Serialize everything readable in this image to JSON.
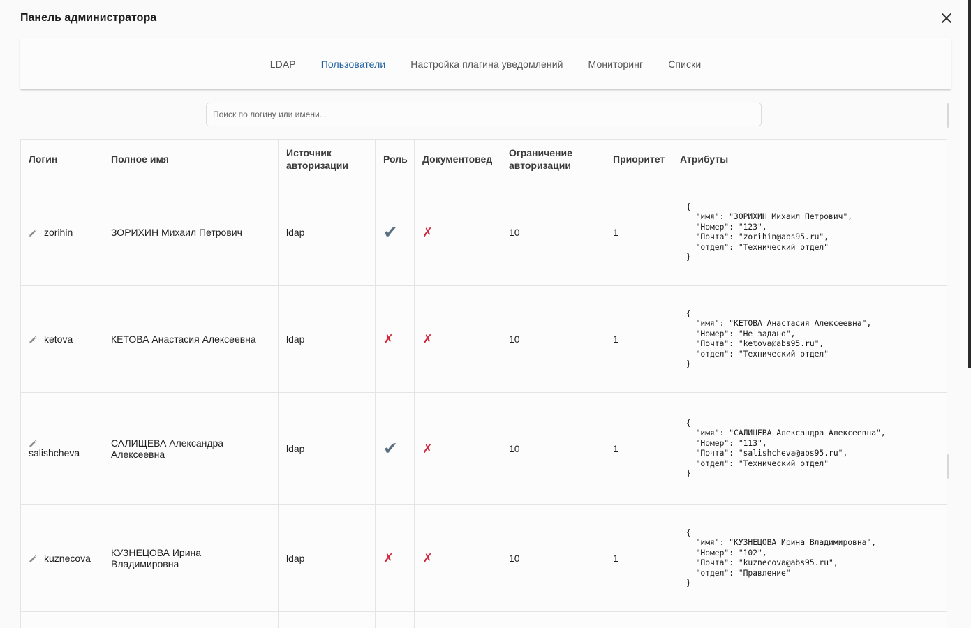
{
  "dialog": {
    "title": "Панель администратора"
  },
  "tabs": [
    {
      "label": "LDAP",
      "active": false
    },
    {
      "label": "Пользователи",
      "active": true
    },
    {
      "label": "Настройка плагина уведомлений",
      "active": false
    },
    {
      "label": "Мониторинг",
      "active": false
    },
    {
      "label": "Списки",
      "active": false
    }
  ],
  "search": {
    "placeholder": "Поиск по логину или имени...",
    "value": ""
  },
  "table": {
    "headers": {
      "login": "Логин",
      "full_name": "Полное имя",
      "auth_source": "Источник авторизации",
      "role": "Роль",
      "doc_manager": "Документовед",
      "auth_limit": "Ограничение авторизации",
      "priority": "Приоритет",
      "attributes": "Атрибуты"
    },
    "rows": [
      {
        "login": "zorihin",
        "full_name": "ЗОРИХИН Михаил Петрович",
        "auth_source": "ldap",
        "role": true,
        "doc_manager": false,
        "auth_limit": "10",
        "priority": "1",
        "attributes": "{\n  \"имя\": \"ЗОРИХИН Михаил Петрович\",\n  \"Номер\": \"123\",\n  \"Почта\": \"zorihin@abs95.ru\",\n  \"отдел\": \"Технический отдел\"\n}"
      },
      {
        "login": "ketova",
        "full_name": "КЕТОВА Анастасия Алексеевна",
        "auth_source": "ldap",
        "role": false,
        "doc_manager": false,
        "auth_limit": "10",
        "priority": "1",
        "attributes": "{\n  \"имя\": \"КЕТОВА Анастасия Алексеевна\",\n  \"Номер\": \"Не задано\",\n  \"Почта\": \"ketova@abs95.ru\",\n  \"отдел\": \"Технический отдел\"\n}"
      },
      {
        "login": "salishcheva",
        "full_name": "САЛИЩЕВА Александра Алексеевна",
        "auth_source": "ldap",
        "role": true,
        "doc_manager": false,
        "auth_limit": "10",
        "priority": "1",
        "attributes": "{\n  \"имя\": \"САЛИЩЕВА Александра Алексеевна\",\n  \"Номер\": \"113\",\n  \"Почта\": \"salishcheva@abs95.ru\",\n  \"отдел\": \"Технический отдел\"\n}"
      },
      {
        "login": "kuznecova",
        "full_name": "КУЗНЕЦОВА Ирина Владимировна",
        "auth_source": "ldap",
        "role": false,
        "doc_manager": false,
        "auth_limit": "10",
        "priority": "1",
        "attributes": "{\n  \"имя\": \"КУЗНЕЦОВА Ирина Владимировна\",\n  \"Номер\": \"102\",\n  \"Почта\": \"kuznecova@abs95.ru\",\n  \"отдел\": \"Правление\"\n}"
      }
    ]
  },
  "icons": {
    "close": "close-icon",
    "edit": "pencil-icon",
    "yes": "checkmark-icon",
    "no": "cross-icon"
  },
  "colors": {
    "active_tab": "#1e5fa0",
    "check": "#5a6f80",
    "cross": "#d0283c"
  }
}
